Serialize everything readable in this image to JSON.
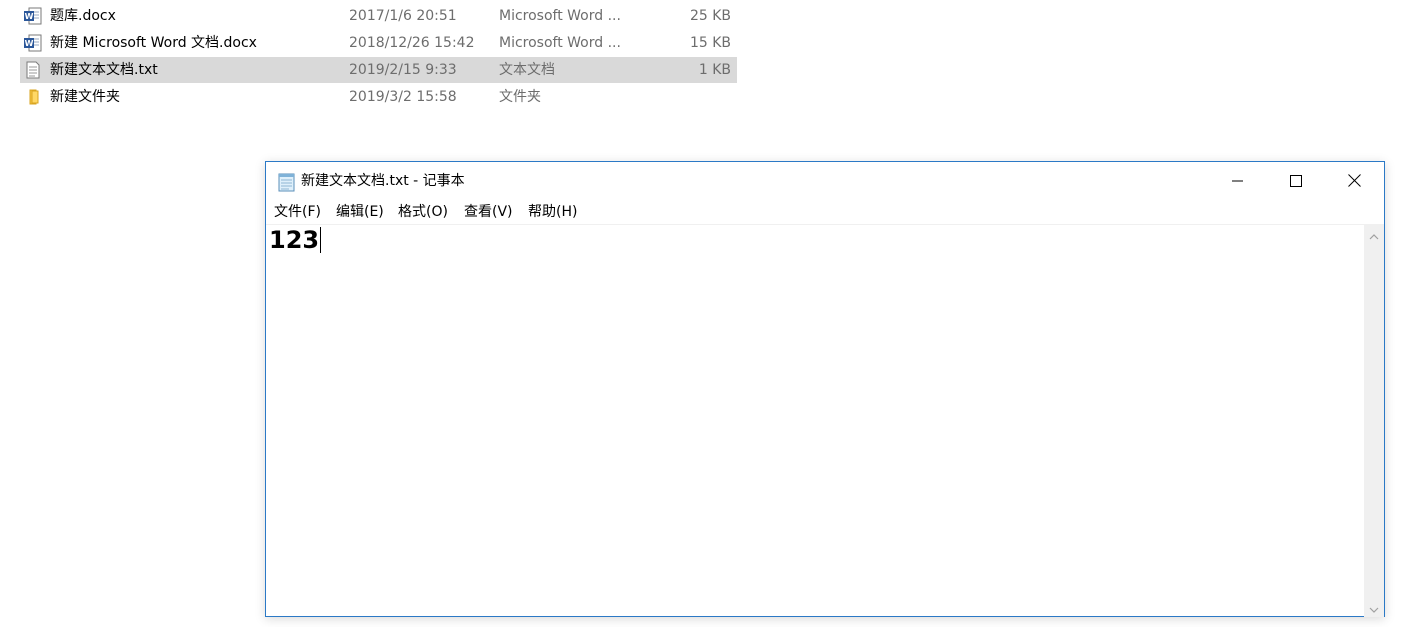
{
  "explorer": {
    "files": [
      {
        "name": "题库.docx",
        "date": "2017/1/6 20:51",
        "type": "Microsoft Word ...",
        "size": "25 KB",
        "icon": "word-doc-icon",
        "selected": false
      },
      {
        "name": "新建 Microsoft Word 文档.docx",
        "date": "2018/12/26 15:42",
        "type": "Microsoft Word ...",
        "size": "15 KB",
        "icon": "word-doc-icon",
        "selected": false
      },
      {
        "name": "新建文本文档.txt",
        "date": "2019/2/15 9:33",
        "type": "文本文档",
        "size": "1 KB",
        "icon": "text-file-icon",
        "selected": true
      },
      {
        "name": "新建文件夹",
        "date": "2019/3/2 15:58",
        "type": "文件夹",
        "size": "",
        "icon": "folder-icon",
        "selected": false
      }
    ]
  },
  "notepad": {
    "title": "新建文本文档.txt - 记事本",
    "menu": {
      "file": "文件(F)",
      "edit": "编辑(E)",
      "format": "格式(O)",
      "view": "查看(V)",
      "help": "帮助(H)"
    },
    "content": "123"
  },
  "colors": {
    "accent_border": "#2b79c6",
    "selected_row": "#d9d9d9",
    "secondary_text": "#6d6d6d",
    "word_icon_blue": "#2b579a",
    "folder_yellow": "#f5c342"
  }
}
